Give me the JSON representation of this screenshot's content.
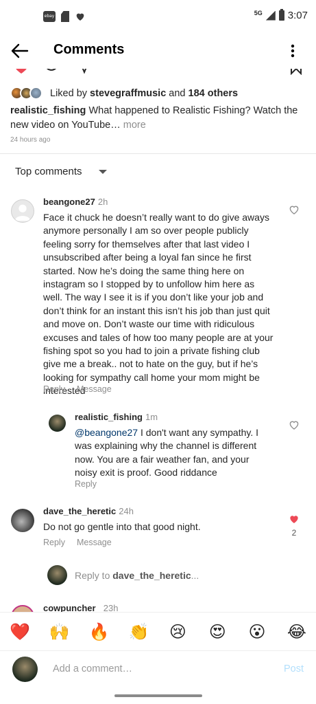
{
  "status_bar": {
    "left_icons": [
      "ebay-icon",
      "sd-card-icon",
      "heart-icon"
    ],
    "ebay_label": "ebay",
    "network": "5G",
    "time": "3:07"
  },
  "header": {
    "title": "Comments"
  },
  "post": {
    "liked_by_prefix": "Liked by",
    "liked_by_user": "stevegraffmusic",
    "liked_by_and": "and",
    "liked_by_others": "184 others",
    "caption_user": "realistic_fishing",
    "caption_text": "What happened to Realistic Fishing? Watch the new video on YouTube",
    "caption_ellipsis": "…",
    "more_label": "more",
    "time": "24 hours ago"
  },
  "sort": {
    "label": "Top comments"
  },
  "comments": [
    {
      "user": "beangone27",
      "time": "2h",
      "text": "Face it chuck he doesn’t really want to do give aways anymore personally I am so over people publicly feeling sorry for themselves after that last video I unsubscribed after being a loyal fan since he first started.  Now he’s doing the same thing here on instagram so I stopped by to unfollow him here as well. The way I see it is if you don’t like your job and don’t think for an instant this isn’t his job than just quit and move on. Don’t waste our time with ridiculous excuses and tales of how too many people are at your fishing spot so you had to join a private fishing club give me a break.. not to hate on the guy, but if he’s looking for sympathy call home your mom might be interested",
      "reply_label": "Reply",
      "message_label": "Message"
    },
    {
      "user": "realistic_fishing",
      "time": "1m",
      "mention": "@beangone27",
      "text": " I don't want any sympathy. I was explaining why the channel is different now. You are a fair weather fan, and your noisy exit is proof. Good riddance",
      "reply_label": "Reply"
    },
    {
      "user": "dave_the_heretic",
      "time": "24h",
      "text": "Do not go gentle into that good night.",
      "likes": "2",
      "reply_label": "Reply",
      "message_label": "Message"
    },
    {
      "user": "cowpuncher_",
      "time": "23h"
    }
  ],
  "reply_to": {
    "prefix": "Reply to",
    "user": "dave_the_heretic",
    "ellipsis": "..."
  },
  "emoji_bar": [
    "❤️",
    "🙌",
    "🔥",
    "👏",
    "😢",
    "😍",
    "😮",
    "😂"
  ],
  "composer": {
    "placeholder": "Add a comment…",
    "post_label": "Post"
  },
  "colors": {
    "liked_heart": "#ed4956",
    "link": "#00376b",
    "muted": "#8e8e8e",
    "post_disabled": "#b2dffc"
  }
}
